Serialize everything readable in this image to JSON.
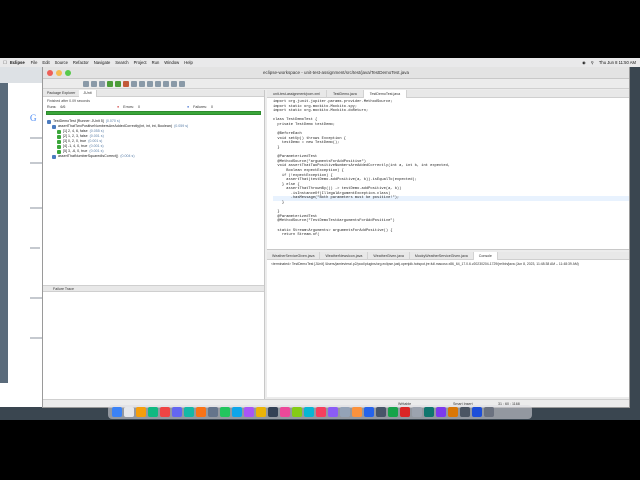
{
  "menubar": {
    "app": "Eclipse",
    "items": [
      "File",
      "Edit",
      "Source",
      "Refactor",
      "Navigate",
      "Search",
      "Project",
      "Run",
      "Window",
      "Help"
    ],
    "clock": "Thu Jun 8  11:50 AM"
  },
  "window": {
    "title": "eclipse-workspace - unit-test-assignment/src/test/java/TestDemoTest.java"
  },
  "left_pane": {
    "tabs": [
      "Package Explorer",
      "JUnit"
    ],
    "finished": "Finished after 0.09 seconds",
    "runs_label": "Runs:",
    "runs_value": "6/6",
    "errors_label": "Errors:",
    "errors_value": "0",
    "failures_label": "Failures:",
    "failures_value": "0",
    "tree": [
      {
        "label": "TestDemoTest [Runner: JUnit 5]",
        "time": "(0.070 s)",
        "indent": 0
      },
      {
        "label": "assertThatTwoPositiveNumbersAreAddedCorrectly(int, int, int, Boolean)",
        "time": "(0.059 s)",
        "indent": 1
      },
      {
        "label": "[1] 2, 4, 6, false",
        "time": "(0.055 s)",
        "indent": 2
      },
      {
        "label": "[2] 1, 2, 3, false",
        "time": "(0.001 s)",
        "indent": 2
      },
      {
        "label": "[3] 0, 2, 0, true",
        "time": "(0.001 s)",
        "indent": 2
      },
      {
        "label": "[4] -1, 4, 0, true",
        "time": "(0.001 s)",
        "indent": 2
      },
      {
        "label": "[5] 3, -6, 0, true",
        "time": "(0.001 s)",
        "indent": 2
      },
      {
        "label": "assertThatNumberSquaredIsCorrect()",
        "time": "(0.004 s)",
        "indent": 1
      }
    ],
    "failure_trace": "Failure Trace"
  },
  "editor": {
    "tabs": [
      "unit-test-assignment/pom.xml",
      "TestDemo.java",
      "TestDemoTest.java"
    ],
    "active_tab": 2,
    "code": [
      "import org.junit.jupiter.params.provider.MethodSource;",
      "import static org.mockito.Mockito.spy;",
      "import static org.mockito.Mockito.doReturn;",
      "",
      "class TestDemoTest {",
      "  private TestDemo testDemo;",
      "",
      "  @BeforeEach",
      "  void setUp() throws Exception {",
      "    testDemo = new TestDemo();",
      "  }",
      "",
      "  @ParameterizedTest",
      "  @MethodSource(\"argumentsForAddPositive\")",
      "  void assertThatTwoPositiveNumbersAreAddedCorrectly(int a, int b, int expected,",
      "      Boolean expectException) {",
      "    if (!expectException) {",
      "      assertThat(testDemo.addPositive(a, b)).isEqualTo(expected);",
      "    } else {",
      "      assertThatThrownBy(() -> testDemo.addPositive(a, b))",
      "        .isInstanceOf(IllegalArgumentException.class)",
      "        .hasMessage(\"Both parameters must be positive!\");",
      "    }",
      "",
      "  }",
      "  @ParameterizedTest",
      "  @MethodSource(\"TestDemoTest#argumentsForAddPositive\")",
      "",
      "  static Stream<Arguments> argumentsForAddPositive() {",
      "    return Stream.of("
    ],
    "highlight_line": 21
  },
  "console": {
    "tabs": [
      "WeatherServiceGiven.java",
      "WeatherNewsIcon.java",
      "WeatherGiven.java",
      "MockyWeatherServiceGiven.java",
      "Console"
    ],
    "active_tab": 4,
    "line": "<terminated> TestDemoTest [JUnit] /Users/jamieviera/.p2/pool/plugins/org.eclipse.justj.openjdk.hotspot.jre.full.macosx.x86_64_17.0.6.v20230204-1729/jre/bin/java  (Jun 8, 2023, 11:48:38 AM – 11:48:39 AM)"
  },
  "statusbar": {
    "mode": "Writable",
    "insert": "Smart Insert",
    "position": "31 : 60 : 1168"
  }
}
